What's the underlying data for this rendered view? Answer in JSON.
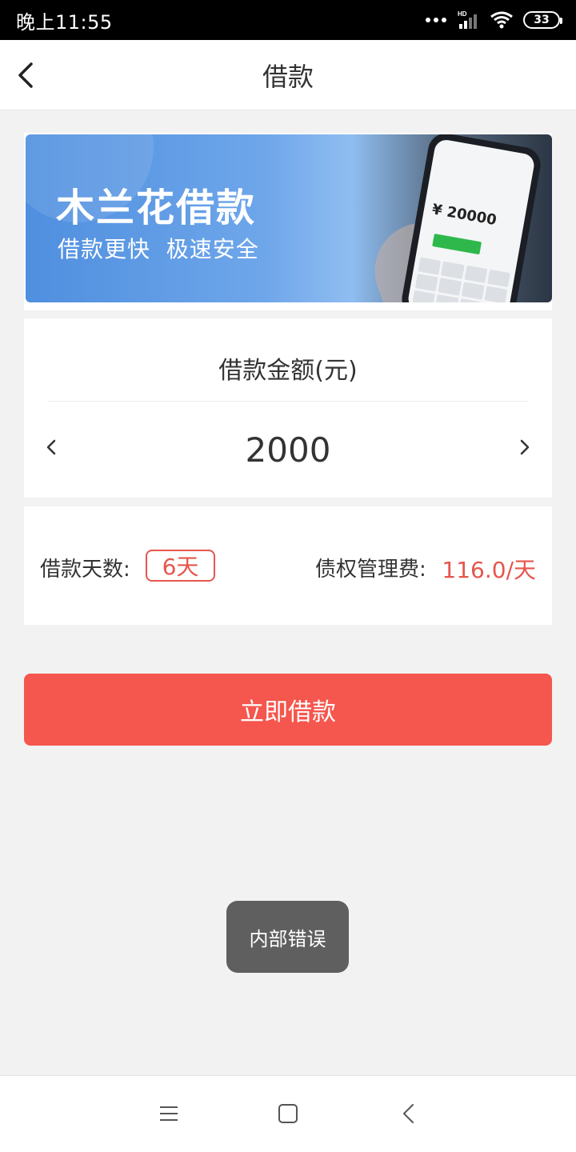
{
  "status_bar": {
    "time": "晚上11:55",
    "network": "HD",
    "battery": "33"
  },
  "header": {
    "title": "借款"
  },
  "banner": {
    "title": "木兰花借款",
    "subtitle": "借款更快  极速安全",
    "phone_amount": "¥ 20000"
  },
  "loan": {
    "amount_label": "借款金额(元)",
    "amount_value": "2000",
    "days_label": "借款天数:",
    "days_value": "6天",
    "fee_label": "债权管理费:",
    "fee_value": "116.0/天"
  },
  "actions": {
    "submit_label": "立即借款"
  },
  "toast": {
    "message": "内部错误"
  },
  "colors": {
    "accent": "#f5564d",
    "accent_text": "#e6564c",
    "background": "#f2f2f2"
  },
  "icons": {
    "back": "chevron-left-icon",
    "prev": "chevron-left-icon",
    "next": "chevron-right-icon",
    "menu": "menu-icon",
    "home": "home-square-icon",
    "sys_back": "back-icon"
  }
}
